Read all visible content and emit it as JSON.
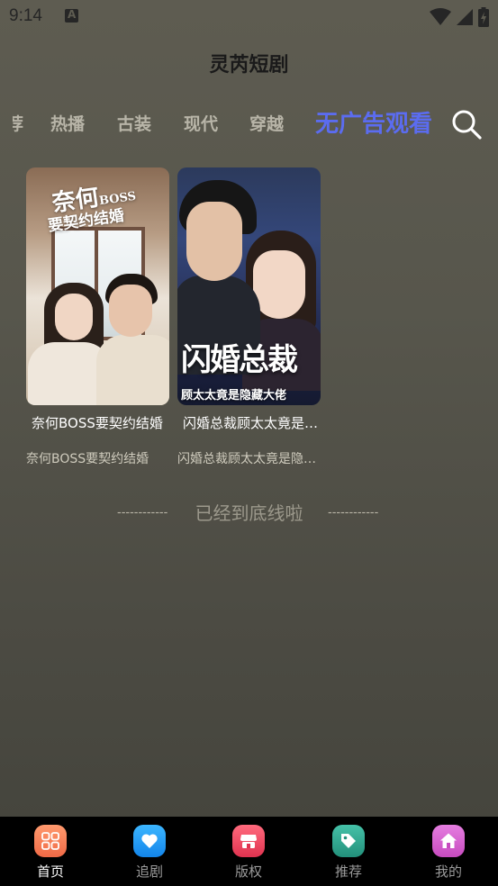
{
  "status_bar": {
    "time": "9:14",
    "notification_icon": "font-a-icon",
    "icons": [
      "wifi-icon",
      "signal-icon",
      "battery-charging-icon"
    ]
  },
  "header": {
    "title": "灵芮短剧"
  },
  "tabs": {
    "partial": "推荐",
    "items": [
      "热播",
      "古装",
      "现代",
      "穿越"
    ],
    "active": "无广告观看",
    "active_color": "#5b6cf0",
    "search_icon": "search-icon"
  },
  "dramas": [
    {
      "name": "奈何BOSS要契约结婚",
      "description": "奈何BOSS要契约结婚",
      "cover_title": "奈何",
      "cover_title_en": "BOSS",
      "cover_subtitle": "要契约结婚"
    },
    {
      "name": "闪婚总裁顾太太竟是隐藏大佬",
      "description": "闪婚总裁顾太太竟是隐藏大佬",
      "cover_title": "闪婚总裁",
      "cover_subtitle": "顾太太竟是隐藏大佬"
    }
  ],
  "end_of_list": {
    "dashes": "------------",
    "text": "已经到底线啦"
  },
  "bottom_nav": {
    "items": [
      {
        "label": "首页",
        "icon": "grid-icon",
        "color": "#f4805a",
        "active": true
      },
      {
        "label": "追剧",
        "icon": "heart-icon",
        "color": "#1e9bf5",
        "active": false
      },
      {
        "label": "版权",
        "icon": "shop-icon",
        "color": "#ef4860",
        "active": false
      },
      {
        "label": "推荐",
        "icon": "tag-icon",
        "color": "#2fa892",
        "active": false
      },
      {
        "label": "我的",
        "icon": "home-icon",
        "color": "#d45fc9",
        "active": false
      }
    ]
  }
}
